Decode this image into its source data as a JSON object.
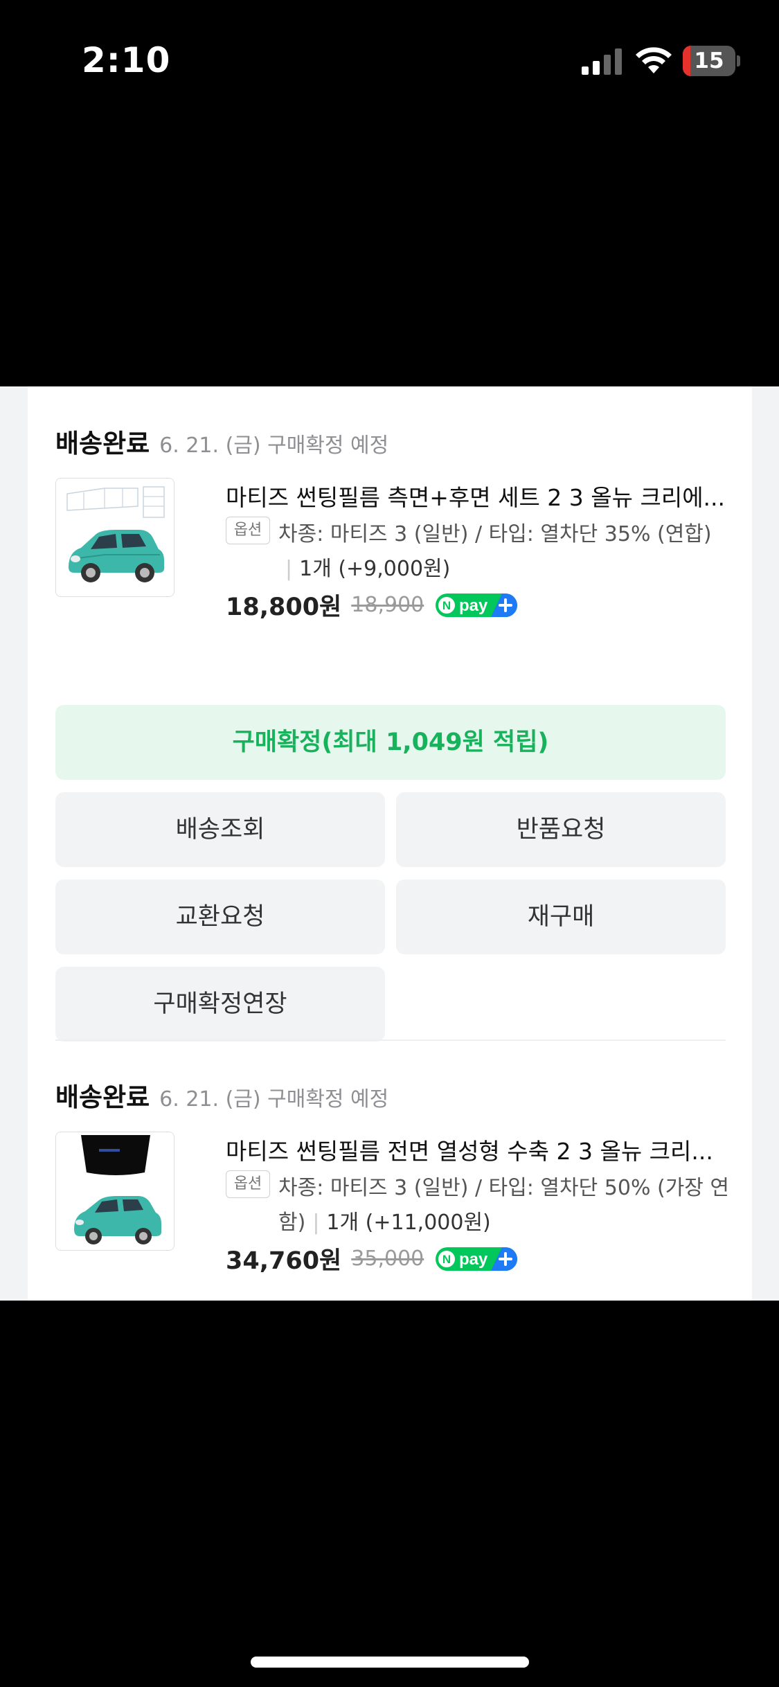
{
  "status_bar": {
    "time": "2:10",
    "battery_level": "15",
    "battery_fraction": 0.15,
    "battery_color": "#e5322d"
  },
  "orders": [
    {
      "status": "배송완료",
      "date_note": "6. 21. (금) 구매확정 예정",
      "title": "마티즈 썬팅필름 측면+후면 세트 2 3 올뉴 크리에...",
      "option_badge": "옵션",
      "option_line1": "차종: 마티즈 3 (일반) / 타입: 열차단 35% (연합)",
      "option_line2_prefix": "",
      "quantity": "1개 (+9,000원)",
      "price": "18,800원",
      "original_price": "18,900",
      "npay_label": "pay"
    },
    {
      "status": "배송완료",
      "date_note": "6. 21. (금) 구매확정 예정",
      "title": "마티즈 썬팅필름 전면 열성형 수축 2 3 올뉴 크리...",
      "option_badge": "옵션",
      "option_line1": "차종: 마티즈 3 (일반) / 타입: 열차단 50% (가장 연",
      "option_line2_prefix": "함)",
      "quantity": "1개 (+11,000원)",
      "price": "34,760원",
      "original_price": "35,000",
      "npay_label": "pay"
    }
  ],
  "actions": {
    "confirm": "구매확정(최대 1,049원 적립)",
    "track": "배송조회",
    "return": "반품요청",
    "exchange": "교환요청",
    "rebuy": "재구매",
    "extend": "구매확정연장"
  },
  "colors": {
    "confirm_text": "#18b25c",
    "confirm_bg": "#e6f7ee",
    "npay_green": "#03c75a",
    "npay_blue": "#1e7bf5"
  }
}
